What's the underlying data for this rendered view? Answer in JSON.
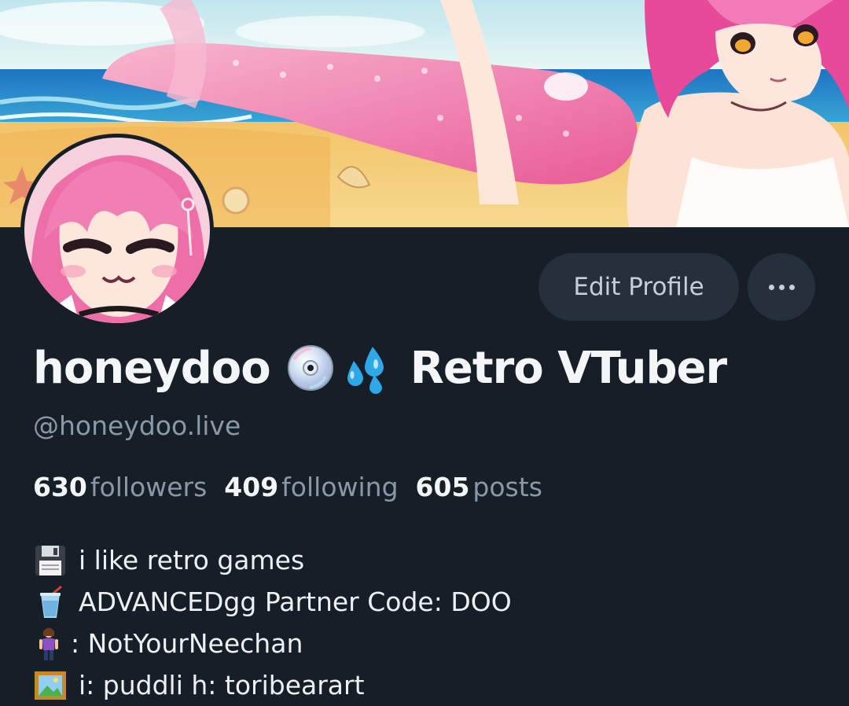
{
  "profile": {
    "display_name_prefix": "honeydoo",
    "display_name_suffix": "Retro VTuber",
    "name_emojis": [
      "cd-icon",
      "sweat-droplets-icon"
    ],
    "handle": "@honeydoo.live"
  },
  "actions": {
    "edit_profile_label": "Edit Profile",
    "more_icon": "ellipsis-icon"
  },
  "stats": [
    {
      "value": "630",
      "label": "followers"
    },
    {
      "value": "409",
      "label": "following"
    },
    {
      "value": "605",
      "label": "posts"
    }
  ],
  "bio": [
    {
      "icon": "floppy-disk-icon",
      "text": "i like retro games"
    },
    {
      "icon": "cup-with-straw-icon",
      "text": "ADVANCEDgg Partner Code: DOO"
    },
    {
      "icon": "woman-standing-icon",
      "text": ": NotYourNeechan"
    },
    {
      "icon": "framed-picture-icon",
      "text": "i: puddli h: toribearart"
    }
  ],
  "colors": {
    "background": "#161e27",
    "button_bg": "#262f3c",
    "muted_text": "#8d98a6",
    "accent_pink": "#f06aa8"
  }
}
